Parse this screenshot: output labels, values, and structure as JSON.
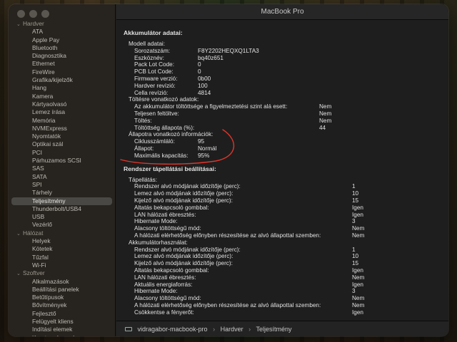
{
  "window_title": "MacBook Pro",
  "sidebar": {
    "groups": [
      {
        "label": "Hardver",
        "items": [
          "ATA",
          "Apple Pay",
          "Bluetooth",
          "Diagnosztika",
          "Ethernet",
          "FireWire",
          "Grafika/kijelzők",
          "Hang",
          "Kamera",
          "Kártyaolvasó",
          "Lemez írása",
          "Memória",
          "NVMExpress",
          "Nyomtatók",
          "Optikai szál",
          "PCI",
          "Párhuzamos SCSI",
          "SAS",
          "SATA",
          "SPI",
          "Tárhely",
          "Teljesítmény",
          "Thunderbolt/USB4",
          "USB",
          "Vezérlő"
        ]
      },
      {
        "label": "Hálózat",
        "items": [
          "Helyek",
          "Kötetek",
          "Tűzfal",
          "Wi-Fi"
        ]
      },
      {
        "label": "Szoftver",
        "items": [
          "Alkalmazások",
          "Beállítási panelek",
          "Betűtípusok",
          "Bővítmények",
          "Fejlesztő",
          "Felügyelt kliens",
          "Indítási elemek",
          "Keretrendszerek"
        ]
      }
    ],
    "selected": "Teljesítmény"
  },
  "battery": {
    "title": "Akkumulátor adatai:",
    "model_header": "Modell adatai:",
    "model": [
      {
        "label": "Sorozatszám:",
        "value": "F8Y2202HEQXQ1LTA3"
      },
      {
        "label": "Eszköznév:",
        "value": "bq40z651"
      },
      {
        "label": "Pack Lot Code:",
        "value": "0"
      },
      {
        "label": "PCB Lot Code:",
        "value": "0"
      },
      {
        "label": "Firmware verzió:",
        "value": "0b00"
      },
      {
        "label": "Hardver revízió:",
        "value": "100"
      },
      {
        "label": "Cella revízió:",
        "value": "4814"
      }
    ],
    "charge_header": "Töltésre vonatkozó adatok:",
    "charge": [
      {
        "label": "Az akkumulátor töltöttsége a figyelmeztetési szint alá esett:",
        "value": "Nem"
      },
      {
        "label": "Teljesen feltöltve:",
        "value": "Nem"
      },
      {
        "label": "Töltés:",
        "value": "Nem"
      },
      {
        "label": "Töltöttség állapota (%):",
        "value": "44"
      }
    ],
    "health_header": "Állapotra vonatkozó információk:",
    "health": [
      {
        "label": "Ciklusszámláló:",
        "value": "95"
      },
      {
        "label": "Állapot:",
        "value": "Normál"
      },
      {
        "label": "Maximális kapacitás:",
        "value": "95%"
      }
    ]
  },
  "power": {
    "title": "Rendszer tápellátási beállításai:",
    "ac_header": "Tápellátás:",
    "ac": [
      {
        "label": "Rendszer alvó módjának időzítője (perc):",
        "value": "1"
      },
      {
        "label": "Lemez alvó módjának időzítője (perc):",
        "value": "10"
      },
      {
        "label": "Kijelző alvó módjának időzítője (perc):",
        "value": "15"
      },
      {
        "label": "Altatás bekapcsoló gombbal:",
        "value": "Igen"
      },
      {
        "label": "LAN hálózati ébresztés:",
        "value": "Igen"
      },
      {
        "label": "Hibernate Mode:",
        "value": "3"
      },
      {
        "label": "Alacsony töltöttségű mód:",
        "value": "Nem"
      },
      {
        "label": "A hálózati elérhetőség előnyben részesítése az alvó állapottal szemben:",
        "value": "Nem"
      }
    ],
    "battery_header": "Akkumulátorhasználat:",
    "battery": [
      {
        "label": "Rendszer alvó módjának időzítője (perc):",
        "value": "1"
      },
      {
        "label": "Lemez alvó módjának időzítője (perc):",
        "value": "10"
      },
      {
        "label": "Kijelző alvó módjának időzítője (perc):",
        "value": "15"
      },
      {
        "label": "Altatás bekapcsoló gombbal:",
        "value": "Igen"
      },
      {
        "label": "LAN hálózati ébresztés:",
        "value": "Nem"
      },
      {
        "label": "Aktuális energiaforrás:",
        "value": "Igen"
      },
      {
        "label": "Hibernate Mode:",
        "value": "3"
      },
      {
        "label": "Alacsony töltöttségű mód:",
        "value": "Nem"
      },
      {
        "label": "A hálózati elérhetőség előnyben részesítése az alvó állapottal szemben:",
        "value": "Nem"
      },
      {
        "label": "Csökkentse a fényerőt:",
        "value": "Igen"
      }
    ]
  },
  "path": {
    "computer": "vidragabor-macbook-pro",
    "section": "Hardver",
    "item": "Teljesítmény"
  },
  "colors": {
    "annotation": "#e0352b",
    "selection": "#4a4844"
  }
}
